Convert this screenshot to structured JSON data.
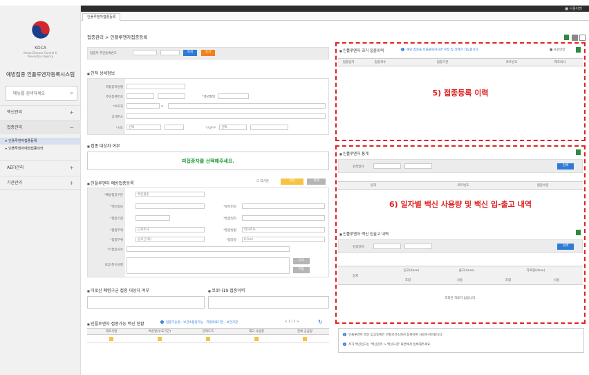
{
  "header": {
    "user_label": "■ 사용자명"
  },
  "tab": {
    "label": "인플루엔자접종등록"
  },
  "sidebar": {
    "logo_text": "KDCA",
    "logo_sub": "Korea Disease Control & Prevention Agency",
    "system_title": "예방접종 인플루엔자등록시스템",
    "search_placeholder": "메뉴를 검색하세요",
    "menus": [
      {
        "label": "백신관리"
      },
      {
        "label": "접종관리"
      },
      {
        "label": "AEFI관리"
      },
      {
        "label": "기관관리"
      }
    ],
    "submenus": [
      {
        "label": "▸ 인플루엔자접종등록"
      },
      {
        "label": "▸ 인플루엔자예방접종이력"
      }
    ]
  },
  "breadcrumb": "접종관리 > 인플루엔자접종등록",
  "search_row": {
    "label": "접종자 주민등록번호",
    "search_btn": "조회",
    "reset_btn": "초기"
  },
  "sections": {
    "personal": "인적 상세정보",
    "target": "접종 대상자 여부",
    "register": "인플루엔자 예방접종등록",
    "covid": "이로신 폐렴구균 접종 대상자 여부",
    "corona": "코로나19 접종이력",
    "vaccine_status": "인플루엔자 접종가능 백신 현황"
  },
  "personal_fields": {
    "name": "피접종자성명",
    "rrn": "주민등록번호",
    "birth": "*생년월일",
    "guardian": "*보호자",
    "address": "상세주소",
    "sido": "*시도",
    "sigungu": "*시군구",
    "select": "선택"
  },
  "target_notice": "피접종자를 선택해주세요.",
  "register_fields": {
    "check_label": "타기관",
    "btn_save": "저장",
    "btn_delete": "삭제",
    "type": "*예방접종구분",
    "type_val": "백신접종",
    "vaccine": "*백신정보",
    "institution": "*접종기관",
    "lot": "*로트번호",
    "date": "*접종일자",
    "doctor": "*접종의사",
    "site": "*접종부위",
    "site_val": "근육주사",
    "method": "*접종방법",
    "method_val": "피하주사",
    "position": "*접종부위",
    "position_val": "삼각근(좌)",
    "dose": "*접종량",
    "dose_val": "0.5ml",
    "memo": "*기접종사유",
    "remark": "비고/특이사항",
    "btn1": "임시",
    "btn2": "저장"
  },
  "vaccine_status": {
    "notice": "접종가능일 : 보건소접종가능 · 지정의료기관 · 보건기관",
    "paging": "< 1 / 1 >",
    "headers": [
      "제조사명",
      "백신명(유효기간)",
      "잔여도즈",
      "재고 사용량",
      "전체 공급량"
    ]
  },
  "panel5": {
    "title": "인플루엔자 과거 접종이력",
    "notice": "해당 접종을 더블클릭하시면 수정 및 삭제가 가능합니다.",
    "check_label": "■ 사용안함",
    "headers": [
      "접종일자",
      "접종차수",
      "접종기관",
      "로트번호",
      "제조회사"
    ],
    "overlay": "5) 접종등록 이력"
  },
  "panel6": {
    "stat_title": "인플루엔자 통계",
    "period_label": "검색일자",
    "search_btn": "검색",
    "stat_headers": [
      "일자",
      "로트번호",
      "접종수량"
    ],
    "io_title": "인플루엔자 백신 입출고 내역",
    "io_headers_top": [
      "입고(dose)",
      "출고(dose)",
      "자료량(dose)"
    ],
    "io_headers_sub": [
      "조합",
      "사용",
      "조합",
      "사용"
    ],
    "io_headers_left": "일자",
    "empty": "조회된 자료가 없습니다.",
    "overlay": "6) 일자별 백신 사용량 및 백신 입-출고 내역"
  },
  "footer_notes": [
    "인플루엔자 백신 입고등록은 관할보건소에서 등록하여 사용하셔야합니다.",
    "추가 백신입고는 '백신관리 > 백신요청' 화면에서 등록해주세요."
  ]
}
